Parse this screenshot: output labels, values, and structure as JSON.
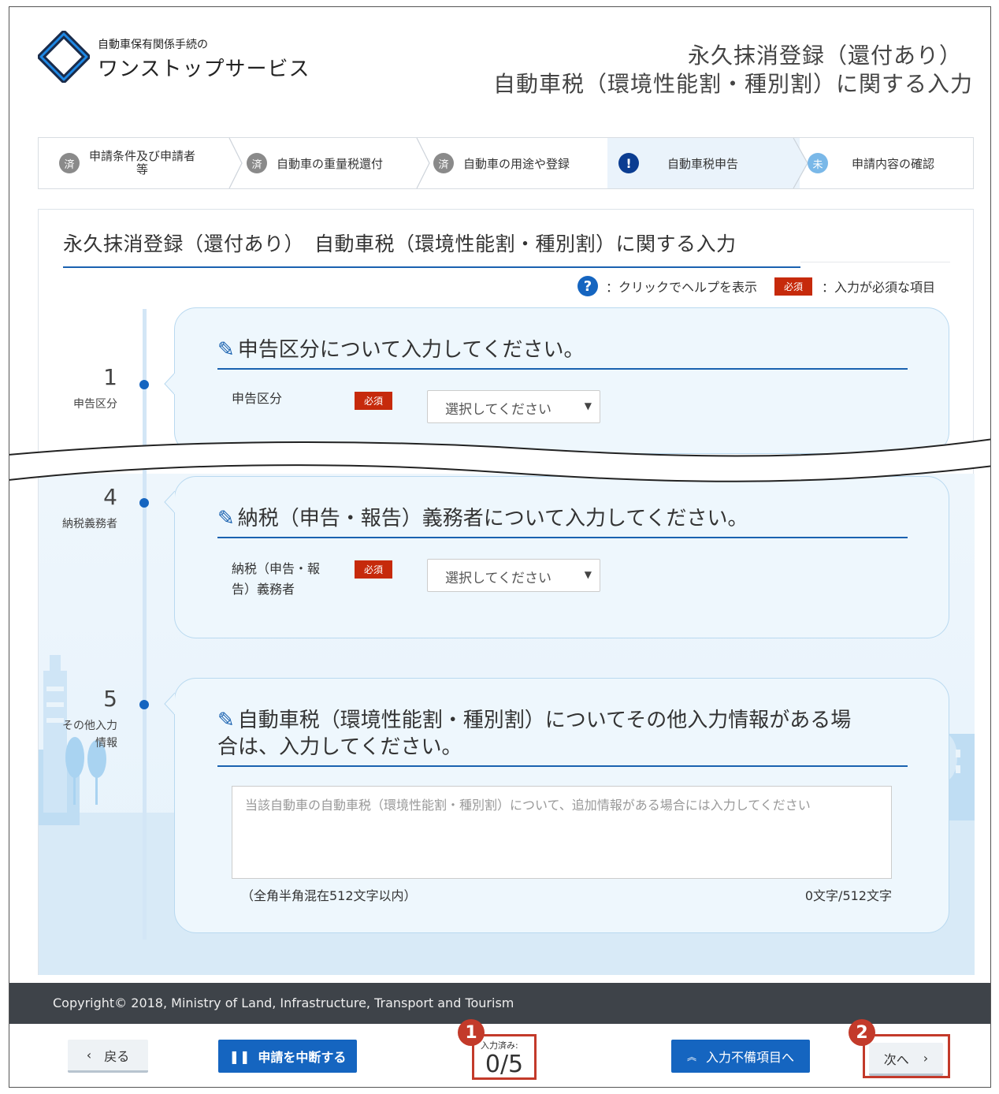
{
  "header": {
    "logo_sub": "自動車保有関係手続の",
    "logo_main": "ワンストップサービス",
    "title_line1": "永久抹消登録（還付あり）",
    "title_line2": "自動車税（環境性能割・種別割）に関する入力"
  },
  "steps": [
    {
      "badge": "済",
      "label_line1": "申請条件及び申請者",
      "label_line2": "等",
      "state": "done"
    },
    {
      "badge": "済",
      "label_line1": "自動車の重量税還付",
      "state": "done"
    },
    {
      "badge": "済",
      "label_line1": "自動車の用途や登録",
      "state": "done"
    },
    {
      "badge": "!",
      "label_line1": "自動車税申告",
      "state": "current"
    },
    {
      "badge": "未",
      "label_line1": "申請内容の確認",
      "state": "todo"
    }
  ],
  "card": {
    "title": "永久抹消登録（還付あり）　自動車税（環境性能割・種別割）に関する入力",
    "legend_help_icon": "?",
    "legend_help": "：クリックでヘルプを表示",
    "legend_required_badge": "必須",
    "legend_required": "：入力が必須な項目"
  },
  "sections": {
    "s1": {
      "num": "1",
      "label": "申告区分",
      "heading": "申告区分について入力してください。",
      "field_label": "申告区分",
      "required": "必須",
      "select_value": "選択してください"
    },
    "s4": {
      "num": "4",
      "label": "納税義務者",
      "heading": "納税（申告・報告）義務者について入力してください。",
      "field_label_line1": "納税（申告・報",
      "field_label_line2": "告）義務者",
      "required": "必須",
      "select_value": "選択してください"
    },
    "s5": {
      "num": "5",
      "label": "その他入力情報",
      "heading_line1": "自動車税（環境性能割・種別割）についてその他入力情報がある場",
      "heading_line2": "合は、入力してください。",
      "placeholder": "当該自動車の自動車税（環境性能割・種別割）について、追加情報がある場合には入力してください",
      "note": "（全角半角混在512文字以内）",
      "count": "0文字/512文字"
    }
  },
  "footer": {
    "copyright": "Copyright© 2018, Ministry of Land, Infrastructure, Transport and Tourism",
    "back": "戻る",
    "pause": "申請を中断する",
    "progress_label": "入力済み:",
    "progress_value": "0/5",
    "invalid_items": "入力不備項目へ",
    "next": "次へ",
    "marker1": "1",
    "marker2": "2"
  },
  "colors": {
    "accent": "#1565c0",
    "required": "#c62a0b",
    "annotation": "#c33a2a",
    "footer_bg": "#3e4349"
  }
}
